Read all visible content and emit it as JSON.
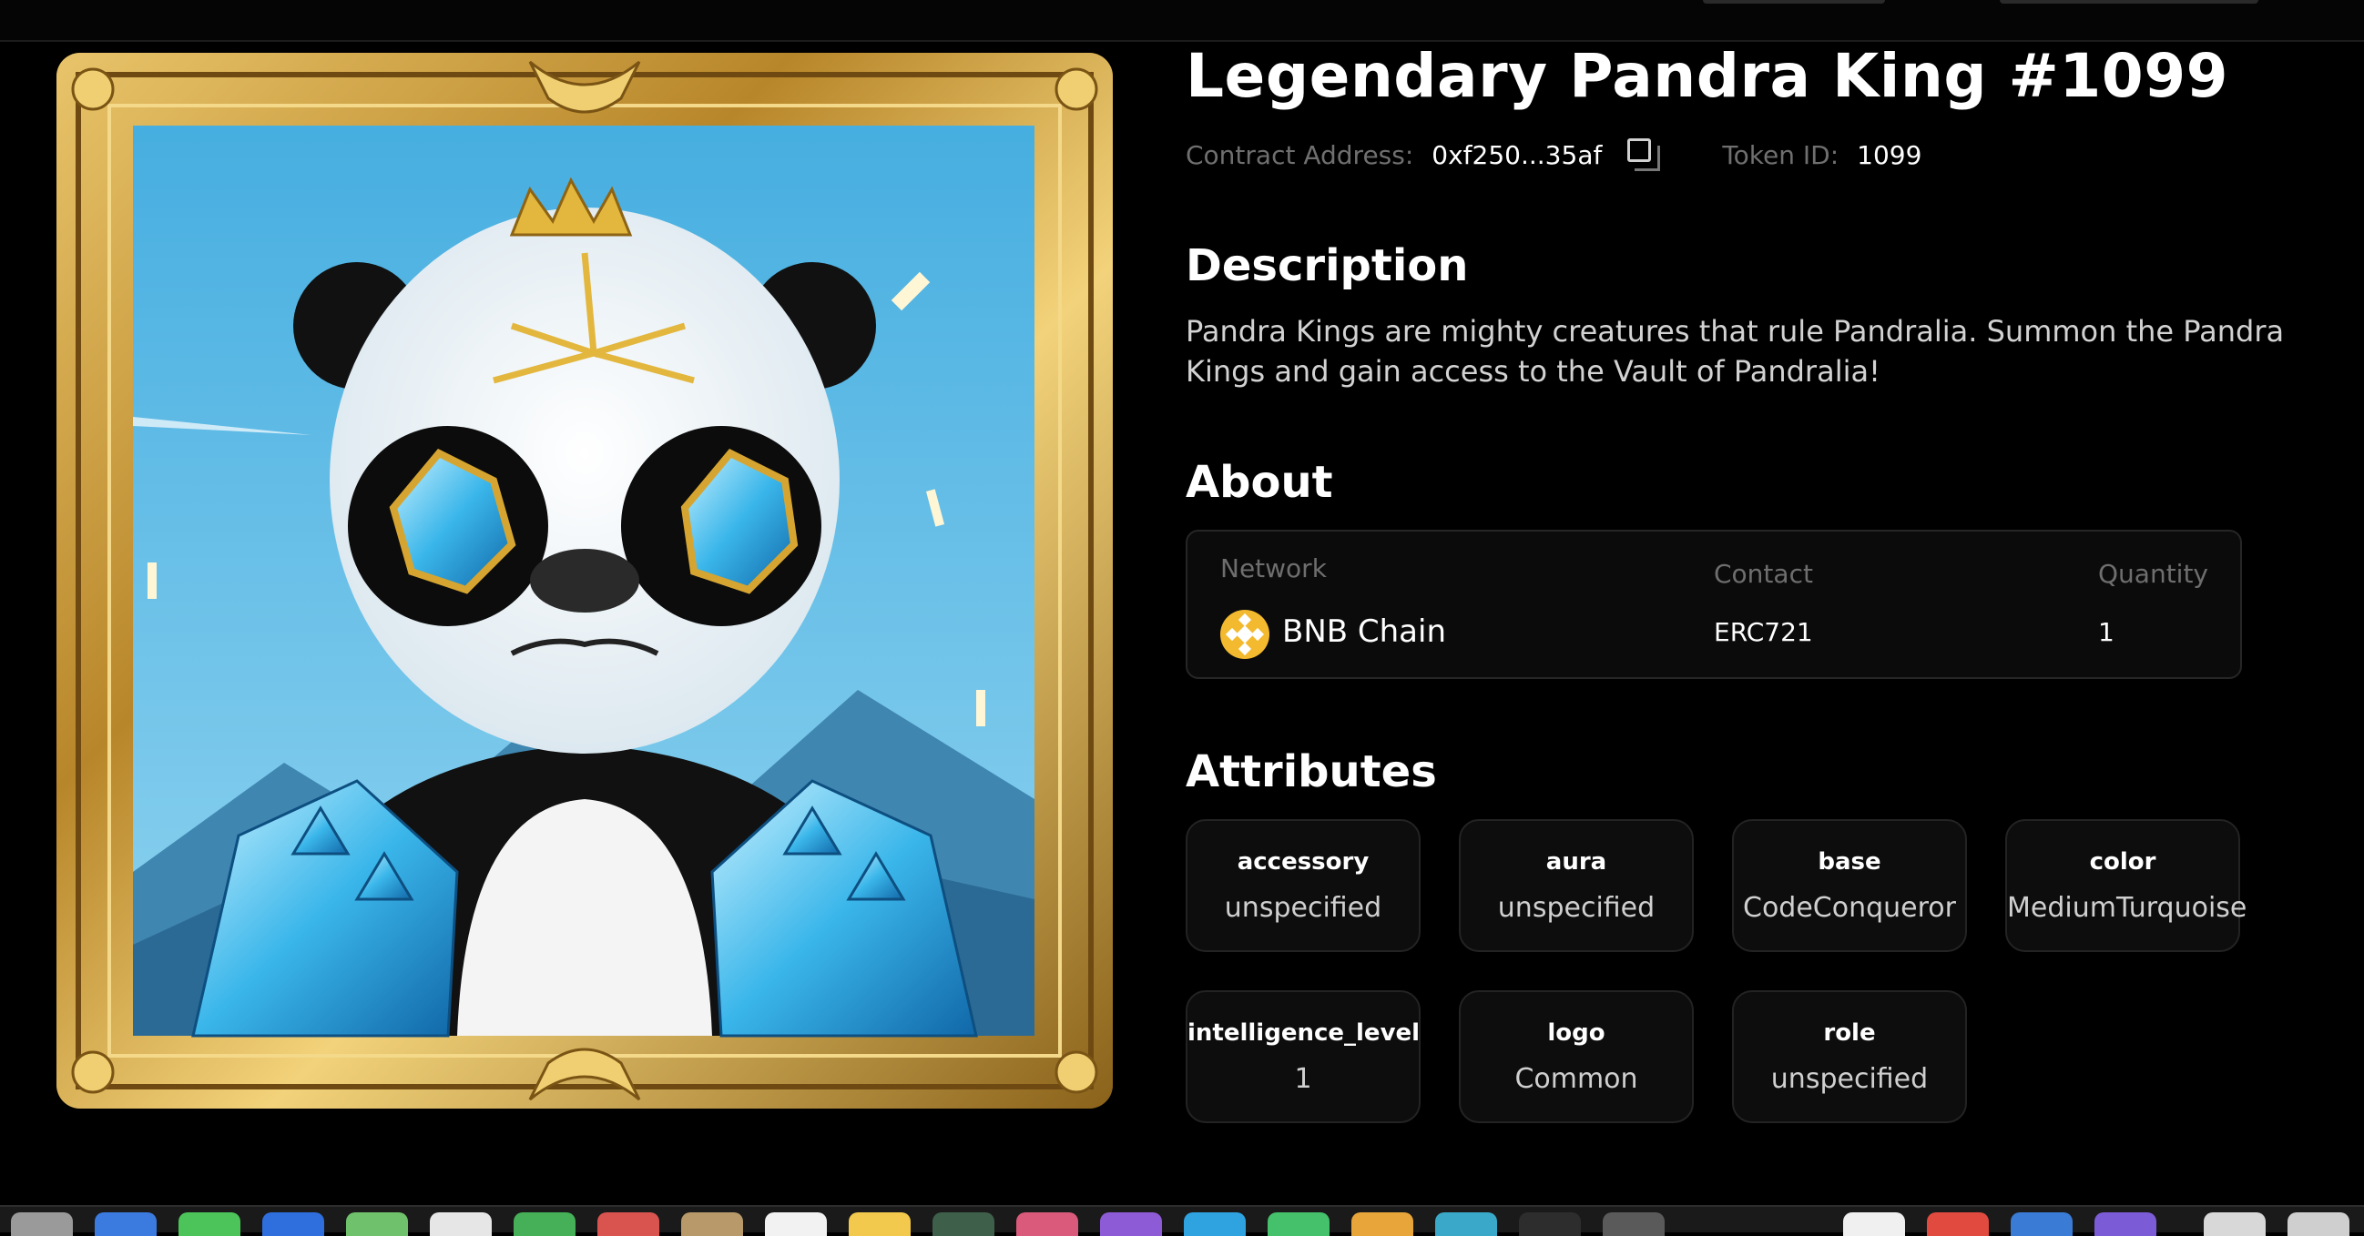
{
  "nft": {
    "title": "Legendary Pandra King #1099",
    "contract_label": "Contract Address:",
    "contract_value": "0xf250...35af",
    "token_label": "Token ID:",
    "token_value": "1099"
  },
  "description": {
    "heading": "Description",
    "text": "Pandra Kings are mighty creatures that rule Pandralia. Summon the Pandra Kings and gain access to the Vault of Pandralia!"
  },
  "about": {
    "heading": "About",
    "network_label": "Network",
    "network_value": "BNB Chain",
    "contact_label": "Contact",
    "contact_value": "ERC721",
    "quantity_label": "Quantity",
    "quantity_value": "1"
  },
  "attributes": {
    "heading": "Attributes",
    "items": [
      {
        "key": "accessory",
        "value": "unspecified"
      },
      {
        "key": "aura",
        "value": "unspecified"
      },
      {
        "key": "base",
        "value": "CodeConqueror"
      },
      {
        "key": "color",
        "value": "MediumTurquoise"
      },
      {
        "key": "intelligence_level",
        "value": "1"
      },
      {
        "key": "logo",
        "value": "Common"
      },
      {
        "key": "role",
        "value": "unspecified"
      }
    ]
  },
  "icons": {
    "copy": "copy-icon",
    "network": "bnb-chain-icon"
  },
  "colors": {
    "background": "#000000",
    "card": "#0d0d0d",
    "muted_text": "#6f6f6f",
    "bnb": "#f3ba2f",
    "frame_gold": "#c99a2e",
    "sky": "#5fbde3"
  }
}
